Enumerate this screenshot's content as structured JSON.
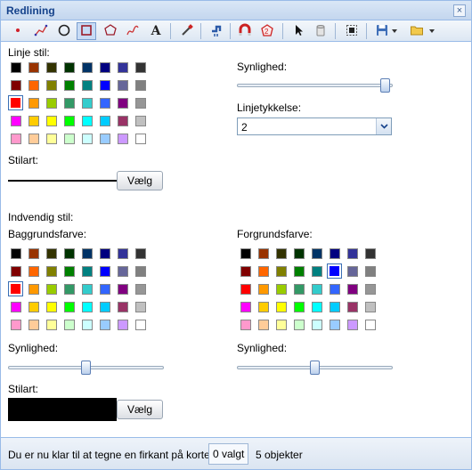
{
  "window": {
    "title": "Redlining",
    "close_label": "×"
  },
  "toolbar": {
    "tools": [
      {
        "name": "point-tool",
        "icon": "point-icon",
        "active": false
      },
      {
        "name": "line-tool",
        "icon": "line-icon",
        "active": false
      },
      {
        "name": "circle-tool",
        "icon": "circle-icon",
        "active": false
      },
      {
        "name": "rectangle-tool",
        "icon": "rectangle-icon",
        "active": true
      },
      {
        "name": "polygon-tool",
        "icon": "polygon-icon",
        "active": false
      },
      {
        "name": "freehand-tool",
        "icon": "freehand-icon",
        "active": false
      },
      {
        "name": "text-tool",
        "icon": "text-icon",
        "active": false
      },
      {
        "name": "eyedropper-tool",
        "icon": "eyedropper-icon",
        "active": false
      },
      {
        "name": "measure-tool",
        "icon": "measure-icon",
        "active": false
      },
      {
        "name": "snap-tool",
        "icon": "magnet-icon",
        "active": false
      },
      {
        "name": "edit-vertices-tool",
        "icon": "edit-polygon-icon",
        "active": false
      },
      {
        "name": "select-tool",
        "icon": "arrow-pointer-icon",
        "active": false
      },
      {
        "name": "delete-tool",
        "icon": "trash-icon",
        "active": false
      },
      {
        "name": "select-all-tool",
        "icon": "select-all-icon",
        "active": false
      },
      {
        "name": "save-tool",
        "icon": "save-icon",
        "active": false
      },
      {
        "name": "open-tool",
        "icon": "folder-icon",
        "active": false
      }
    ],
    "text_glyph": "A"
  },
  "line_style": {
    "heading": "Linje stil:",
    "visibility_label": "Synlighed:",
    "visibility": 0.98,
    "thickness_label": "Linjetykkelse:",
    "thickness_value": "2",
    "style_label": "Stilart:",
    "choose_button": "Vælg",
    "selected": [
      2,
      0
    ]
  },
  "interior_style": {
    "heading": "Indvendig stil:",
    "background_label": "Baggrundsfarve:",
    "foreground_label": "Forgrundsfarve:",
    "bg_selected": [
      2,
      0
    ],
    "fg_selected": [
      1,
      5
    ],
    "bg_visibility_label": "Synlighed:",
    "bg_visibility": 0.5,
    "fg_visibility_label": "Synlighed:",
    "fg_visibility": 0.5,
    "style_label": "Stilart:",
    "choose_button": "Vælg"
  },
  "palette": [
    [
      "#000000",
      "#993300",
      "#333300",
      "#003300",
      "#003366",
      "#000080",
      "#333399",
      "#333333"
    ],
    [
      "#800000",
      "#ff6600",
      "#808000",
      "#008000",
      "#008080",
      "#0000ff",
      "#666699",
      "#808080"
    ],
    [
      "#ff0000",
      "#ff9900",
      "#99cc00",
      "#339966",
      "#33cccc",
      "#3366ff",
      "#800080",
      "#969696"
    ],
    [
      "#ff00ff",
      "#ffcc00",
      "#ffff00",
      "#00ff00",
      "#00ffff",
      "#00ccff",
      "#993366",
      "#c0c0c0"
    ],
    [
      "#ff99cc",
      "#ffcc99",
      "#ffff99",
      "#ccffcc",
      "#ccffff",
      "#99ccff",
      "#cc99ff",
      "#ffffff"
    ]
  ],
  "status": {
    "message": "Du er nu klar til at tegne en firkant på kortet.",
    "selected_count": "0 valgt",
    "object_count": "5 objekter"
  },
  "colors": {
    "accent": "#15428b",
    "border": "#99bbe8"
  }
}
